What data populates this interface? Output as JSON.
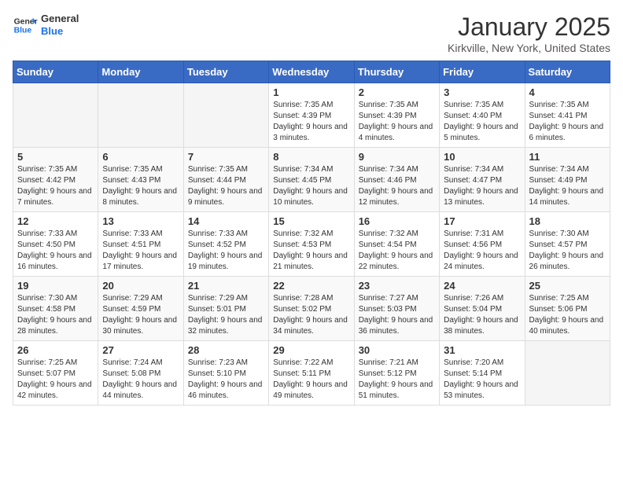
{
  "header": {
    "logo_general": "General",
    "logo_blue": "Blue",
    "month": "January 2025",
    "location": "Kirkville, New York, United States"
  },
  "weekdays": [
    "Sunday",
    "Monday",
    "Tuesday",
    "Wednesday",
    "Thursday",
    "Friday",
    "Saturday"
  ],
  "weeks": [
    [
      {
        "day": "",
        "info": ""
      },
      {
        "day": "",
        "info": ""
      },
      {
        "day": "",
        "info": ""
      },
      {
        "day": "1",
        "info": "Sunrise: 7:35 AM\nSunset: 4:39 PM\nDaylight: 9 hours and 3 minutes."
      },
      {
        "day": "2",
        "info": "Sunrise: 7:35 AM\nSunset: 4:39 PM\nDaylight: 9 hours and 4 minutes."
      },
      {
        "day": "3",
        "info": "Sunrise: 7:35 AM\nSunset: 4:40 PM\nDaylight: 9 hours and 5 minutes."
      },
      {
        "day": "4",
        "info": "Sunrise: 7:35 AM\nSunset: 4:41 PM\nDaylight: 9 hours and 6 minutes."
      }
    ],
    [
      {
        "day": "5",
        "info": "Sunrise: 7:35 AM\nSunset: 4:42 PM\nDaylight: 9 hours and 7 minutes."
      },
      {
        "day": "6",
        "info": "Sunrise: 7:35 AM\nSunset: 4:43 PM\nDaylight: 9 hours and 8 minutes."
      },
      {
        "day": "7",
        "info": "Sunrise: 7:35 AM\nSunset: 4:44 PM\nDaylight: 9 hours and 9 minutes."
      },
      {
        "day": "8",
        "info": "Sunrise: 7:34 AM\nSunset: 4:45 PM\nDaylight: 9 hours and 10 minutes."
      },
      {
        "day": "9",
        "info": "Sunrise: 7:34 AM\nSunset: 4:46 PM\nDaylight: 9 hours and 12 minutes."
      },
      {
        "day": "10",
        "info": "Sunrise: 7:34 AM\nSunset: 4:47 PM\nDaylight: 9 hours and 13 minutes."
      },
      {
        "day": "11",
        "info": "Sunrise: 7:34 AM\nSunset: 4:49 PM\nDaylight: 9 hours and 14 minutes."
      }
    ],
    [
      {
        "day": "12",
        "info": "Sunrise: 7:33 AM\nSunset: 4:50 PM\nDaylight: 9 hours and 16 minutes."
      },
      {
        "day": "13",
        "info": "Sunrise: 7:33 AM\nSunset: 4:51 PM\nDaylight: 9 hours and 17 minutes."
      },
      {
        "day": "14",
        "info": "Sunrise: 7:33 AM\nSunset: 4:52 PM\nDaylight: 9 hours and 19 minutes."
      },
      {
        "day": "15",
        "info": "Sunrise: 7:32 AM\nSunset: 4:53 PM\nDaylight: 9 hours and 21 minutes."
      },
      {
        "day": "16",
        "info": "Sunrise: 7:32 AM\nSunset: 4:54 PM\nDaylight: 9 hours and 22 minutes."
      },
      {
        "day": "17",
        "info": "Sunrise: 7:31 AM\nSunset: 4:56 PM\nDaylight: 9 hours and 24 minutes."
      },
      {
        "day": "18",
        "info": "Sunrise: 7:30 AM\nSunset: 4:57 PM\nDaylight: 9 hours and 26 minutes."
      }
    ],
    [
      {
        "day": "19",
        "info": "Sunrise: 7:30 AM\nSunset: 4:58 PM\nDaylight: 9 hours and 28 minutes."
      },
      {
        "day": "20",
        "info": "Sunrise: 7:29 AM\nSunset: 4:59 PM\nDaylight: 9 hours and 30 minutes."
      },
      {
        "day": "21",
        "info": "Sunrise: 7:29 AM\nSunset: 5:01 PM\nDaylight: 9 hours and 32 minutes."
      },
      {
        "day": "22",
        "info": "Sunrise: 7:28 AM\nSunset: 5:02 PM\nDaylight: 9 hours and 34 minutes."
      },
      {
        "day": "23",
        "info": "Sunrise: 7:27 AM\nSunset: 5:03 PM\nDaylight: 9 hours and 36 minutes."
      },
      {
        "day": "24",
        "info": "Sunrise: 7:26 AM\nSunset: 5:04 PM\nDaylight: 9 hours and 38 minutes."
      },
      {
        "day": "25",
        "info": "Sunrise: 7:25 AM\nSunset: 5:06 PM\nDaylight: 9 hours and 40 minutes."
      }
    ],
    [
      {
        "day": "26",
        "info": "Sunrise: 7:25 AM\nSunset: 5:07 PM\nDaylight: 9 hours and 42 minutes."
      },
      {
        "day": "27",
        "info": "Sunrise: 7:24 AM\nSunset: 5:08 PM\nDaylight: 9 hours and 44 minutes."
      },
      {
        "day": "28",
        "info": "Sunrise: 7:23 AM\nSunset: 5:10 PM\nDaylight: 9 hours and 46 minutes."
      },
      {
        "day": "29",
        "info": "Sunrise: 7:22 AM\nSunset: 5:11 PM\nDaylight: 9 hours and 49 minutes."
      },
      {
        "day": "30",
        "info": "Sunrise: 7:21 AM\nSunset: 5:12 PM\nDaylight: 9 hours and 51 minutes."
      },
      {
        "day": "31",
        "info": "Sunrise: 7:20 AM\nSunset: 5:14 PM\nDaylight: 9 hours and 53 minutes."
      },
      {
        "day": "",
        "info": ""
      }
    ]
  ]
}
